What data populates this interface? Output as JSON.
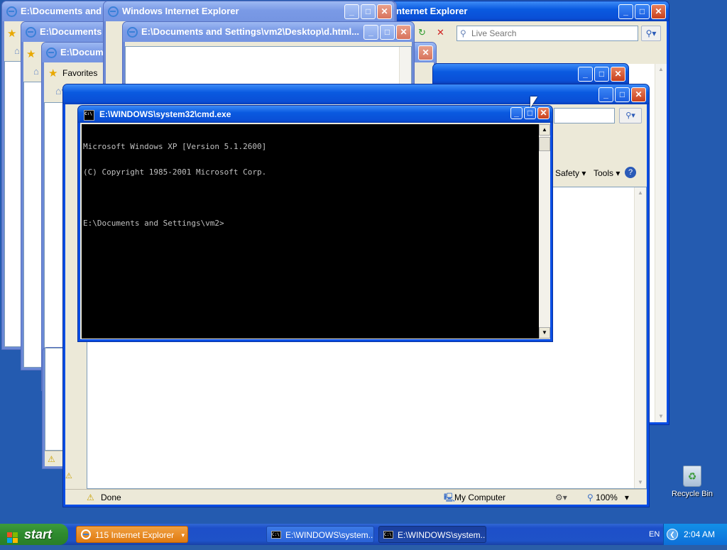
{
  "windows": {
    "w1": {
      "title": "E:\\Documents and S"
    },
    "w2": {
      "title": "E:\\Documents a"
    },
    "w3": {
      "title": "E:\\Documents a"
    },
    "w4": {
      "title": "Windows Internet Explorer"
    },
    "w5": {
      "title": "E:\\Documents and Settings\\vm2\\Desktop\\d.html..."
    },
    "w6": {
      "title": "nternet Explorer",
      "search_placeholder": "Live Search"
    },
    "w8": {
      "status": "Done",
      "zone": "My Computer",
      "zoom": "100%",
      "menu_safety": "Safety",
      "menu_tools": "Tools"
    },
    "favorites_label": "Favorites"
  },
  "cmd": {
    "title": "E:\\WINDOWS\\system32\\cmd.exe",
    "lines": [
      "Microsoft Windows XP [Version 5.1.2600]",
      "(C) Copyright 1985-2001 Microsoft Corp.",
      "",
      "E:\\Documents and Settings\\vm2>"
    ]
  },
  "desktop": {
    "recycle_bin": "Recycle Bin"
  },
  "taskbar": {
    "start": "start",
    "tasks": [
      {
        "label": "115 Internet Explorer"
      },
      {
        "label": "E:\\WINDOWS\\system..."
      },
      {
        "label": "E:\\WINDOWS\\system..."
      }
    ],
    "lang": "EN",
    "clock": "2:04 AM"
  },
  "colors": {
    "title_active": "#0a5ae0",
    "desktop": "#245bb0",
    "console_bg": "#000000",
    "console_fg": "#c0c0c0"
  }
}
